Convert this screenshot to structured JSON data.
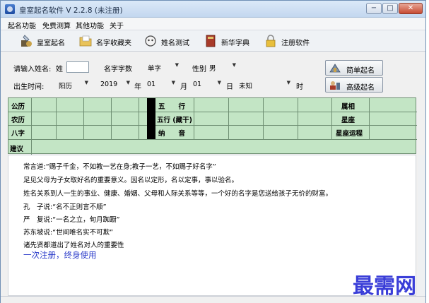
{
  "window": {
    "title": "皇室起名软件 V 2.2.8 (未注册)"
  },
  "window_controls": {
    "minimize": "−",
    "maximize": "□",
    "close": "✕"
  },
  "menu": [
    "起名功能",
    "免费测算",
    "其他功能",
    "关于"
  ],
  "toolbar": [
    {
      "label": "皇室起名",
      "icon": "royal-naming-icon"
    },
    {
      "label": "名字收藏夹",
      "icon": "folder-icon"
    },
    {
      "label": "姓名测试",
      "icon": "test-icon"
    },
    {
      "label": "新华字典",
      "icon": "dictionary-icon"
    },
    {
      "label": "注册软件",
      "icon": "lock-icon"
    }
  ],
  "form": {
    "surname_label": "请输入姓名:",
    "surname_prefix": "姓",
    "surname_value": "",
    "char_count_label": "名字字数",
    "char_count_value": "单字",
    "gender_label": "性别",
    "gender_value": "男",
    "birth_label": "出生时间:",
    "calendar_value": "阳历",
    "year_value": "2019",
    "year_unit": "年",
    "month_value": "01",
    "month_unit": "月",
    "day_value": "01",
    "day_unit": "日",
    "hour_value": "未知",
    "hour_unit": "时"
  },
  "actions": {
    "simple": "简单起名",
    "advanced": "高级起名"
  },
  "grid": {
    "row_labels": [
      "公历",
      "农历",
      "八字",
      "建议"
    ],
    "middle_labels": [
      "五　　行",
      "五行 (藏干)",
      "纳　　音"
    ],
    "right_labels": [
      "属相",
      "星座",
      "星座运程"
    ]
  },
  "notes": [
    "常言道:“赐子千金，不如教一艺在身;教子一艺，不如赐子好名字”",
    "足见父母为子女取好名的重要意义。因名以定形，名以定事，事以验名。",
    "姓名关系到人一生的事业、健康、婚姻、父母和人际关系等等，一个好的名字是您送给孩子无价的财富。",
    "孔　子说:“名不正则言不顺”",
    "严　复说:“一名之立，旬月踟蹰”",
    "苏东坡说:“世间唯名实不可欺”",
    "诸先贤都道出了姓名对人的重要性"
  ],
  "promo": "一次注册，终身使用",
  "watermark": "最需网",
  "colors": {
    "grid_bg": "#c3e5c5",
    "grid_border": "#6e8e72",
    "promo_text": "#2536c8",
    "watermark": "#3a3ed8"
  }
}
